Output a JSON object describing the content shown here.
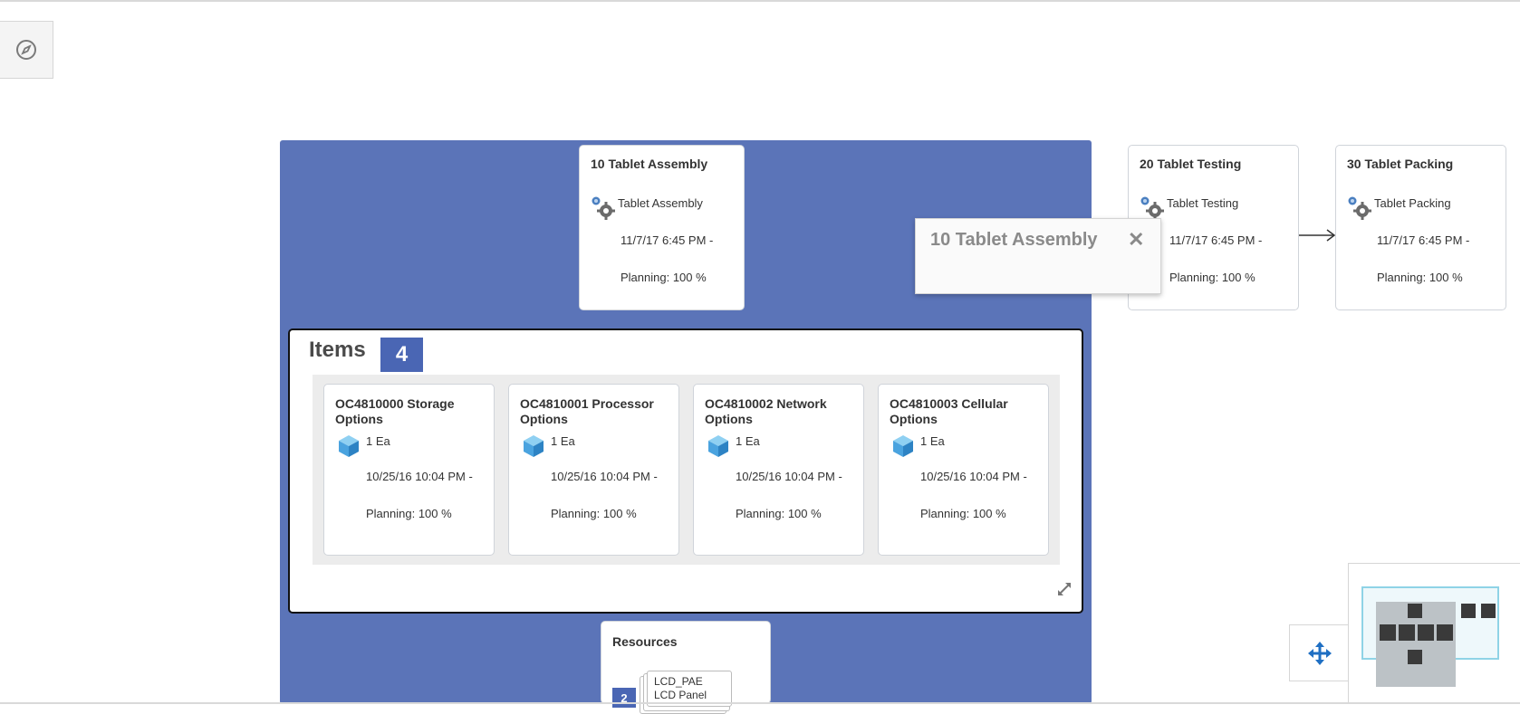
{
  "operations": [
    {
      "title": "10 Tablet Assembly",
      "resource": "Tablet Assembly",
      "date": "11/7/17 6:45 PM -",
      "planning": "Planning: 100 %"
    },
    {
      "title": "20 Tablet Testing",
      "resource": "Tablet Testing",
      "date": "11/7/17 6:45 PM -",
      "planning": "Planning: 100 %"
    },
    {
      "title": "30 Tablet Packing",
      "resource": "Tablet Packing",
      "date": "11/7/17 6:45 PM -",
      "planning": "Planning: 100 %"
    }
  ],
  "items_panel": {
    "title": "Items",
    "count": "4",
    "items": [
      {
        "title": "OC4810000 Storage Options",
        "qty": "1 Ea",
        "date": "10/25/16 10:04 PM -",
        "planning": "Planning: 100 %"
      },
      {
        "title": "OC4810001 Processor Options",
        "qty": "1 Ea",
        "date": "10/25/16 10:04 PM -",
        "planning": "Planning: 100 %"
      },
      {
        "title": "OC4810002 Network Options",
        "qty": "1 Ea",
        "date": "10/25/16 10:04 PM -",
        "planning": "Planning: 100 %"
      },
      {
        "title": "OC4810003 Cellular Options",
        "qty": "1 Ea",
        "date": "10/25/16 10:04 PM -",
        "planning": "Planning: 100 %"
      }
    ]
  },
  "resources_card": {
    "title": "Resources",
    "count": "2",
    "names": [
      "LCD_PAE",
      "LCD Panel"
    ]
  },
  "popup": {
    "title": "10 Tablet Assembly",
    "close": "✕"
  },
  "icons": {
    "compass": "compass-icon",
    "gear": "gear-icon",
    "cube": "cube-icon",
    "expand": "expand-icon",
    "pan": "pan-move-icon",
    "arrow": "arrow-right-icon"
  },
  "colors": {
    "operation_container": "#5b74b8",
    "badge": "#4a66b4",
    "pan_icon": "#1f6fc3",
    "cube": "#4aa3df"
  }
}
